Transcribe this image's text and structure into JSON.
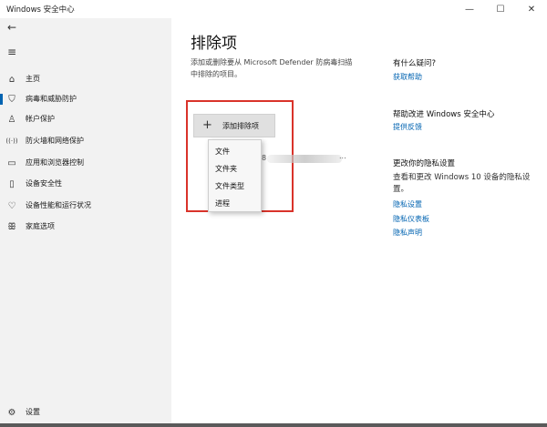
{
  "window": {
    "title": "Windows 安全中心",
    "minimize_icon": "—",
    "maximize_icon": "☐",
    "close_icon": "✕"
  },
  "sidebar": {
    "back_icon": "←",
    "menu_icon": "≡",
    "items": [
      {
        "label": "主页",
        "icon": "home-icon",
        "glyph": "⌂"
      },
      {
        "label": "病毒和威胁防护",
        "icon": "shield-icon",
        "glyph": "⛉"
      },
      {
        "label": "帐户保护",
        "icon": "person-icon",
        "glyph": "♙"
      },
      {
        "label": "防火墙和网络保护",
        "icon": "wifi-icon",
        "glyph": "((·))"
      },
      {
        "label": "应用和浏览器控制",
        "icon": "browser-icon",
        "glyph": "▭"
      },
      {
        "label": "设备安全性",
        "icon": "device-icon",
        "glyph": "▯"
      },
      {
        "label": "设备性能和运行状况",
        "icon": "heart-icon",
        "glyph": "♡"
      },
      {
        "label": "家庭选项",
        "icon": "family-icon",
        "glyph": "ꕥ"
      }
    ],
    "active_index": 1,
    "settings_label": "设置",
    "settings_glyph": "⚙"
  },
  "main": {
    "title": "排除项",
    "description": "添加或删除要从 Microsoft Defender 防病毒扫描中排除的项目。",
    "add_button": {
      "plus": "+",
      "label": "添加排除项"
    },
    "dropdown": [
      "文件",
      "文件夹",
      "文件类型",
      "进程"
    ],
    "blurred_item_start": "8",
    "blurred_item_end": "..."
  },
  "right_panel": {
    "q_heading": "有什么疑问?",
    "q_link": "获取帮助",
    "improve_heading": "帮助改进 Windows 安全中心",
    "improve_link": "提供反馈",
    "privacy_heading": "更改你的隐私设置",
    "privacy_text": "查看和更改 Windows 10 设备的隐私设置。",
    "privacy_links": [
      "隐私设置",
      "隐私仪表板",
      "隐私声明"
    ]
  },
  "colors": {
    "accent": "#0063b1",
    "highlight_border": "#d9332a",
    "sidebar_bg": "#f2f2f2"
  }
}
